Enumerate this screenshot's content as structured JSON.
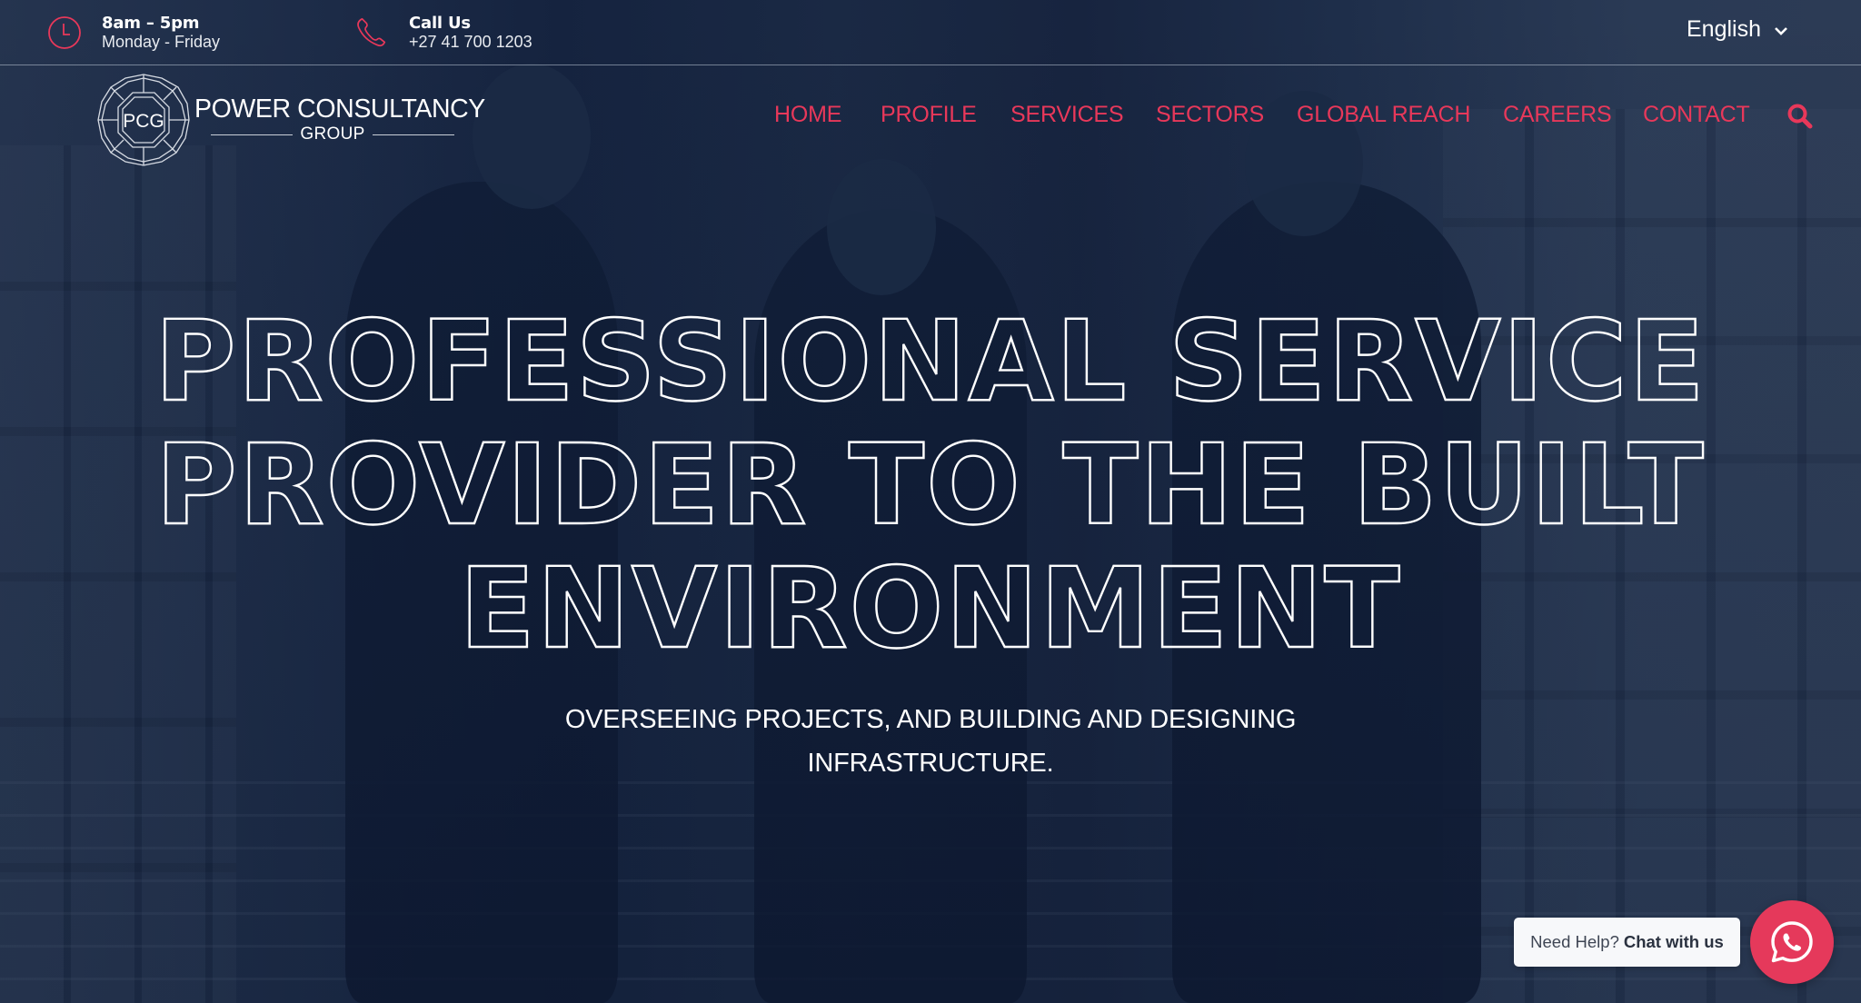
{
  "topbar": {
    "hours": {
      "icon": "clock-icon",
      "title": "8am – 5pm",
      "subtitle": "Monday - Friday"
    },
    "call": {
      "icon": "phone-icon",
      "title": "Call Us",
      "subtitle": "+27 41 700 1203"
    },
    "language": {
      "selected": "English",
      "icon": "chevron-down-icon"
    }
  },
  "brand": {
    "emblem_text": "PCG",
    "name": "POWER CONSULTANCY",
    "sub": "GROUP"
  },
  "nav": {
    "items": [
      {
        "label": "HOME"
      },
      {
        "label": "PROFILE"
      },
      {
        "label": "SERVICES"
      },
      {
        "label": "SECTORS"
      },
      {
        "label": "GLOBAL REACH"
      },
      {
        "label": "CAREERS"
      },
      {
        "label": "CONTACT"
      }
    ],
    "search_icon": "search-icon"
  },
  "hero": {
    "headline_lines": [
      "PROFESSIONAL SERVICE",
      "PROVIDER TO THE BUILT",
      "ENVIRONMENT"
    ],
    "subtitle_lines": [
      "OVERSEEING PROJECTS, AND BUILDING AND DESIGNING",
      "INFRASTRUCTURE."
    ]
  },
  "chat": {
    "prompt": "Need Help?",
    "action": "Chat with us",
    "icon": "whatsapp-icon"
  },
  "colors": {
    "accent": "#e8385a",
    "background": "#1a2740",
    "text": "#ffffff"
  }
}
